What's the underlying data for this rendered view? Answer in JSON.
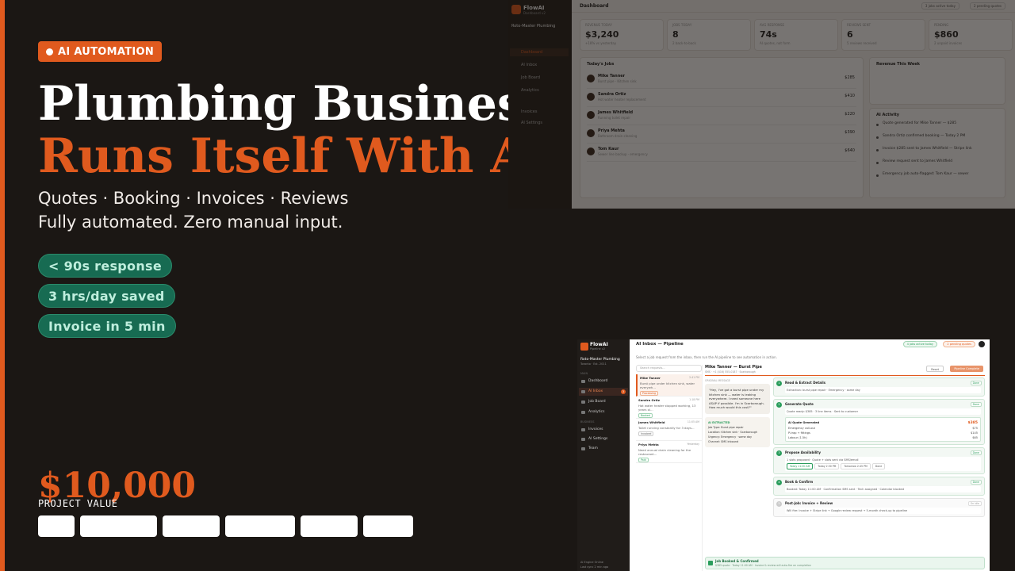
{
  "hero": {
    "badge": "AI AUTOMATION",
    "headline_1": "Plumbing Business",
    "headline_2": "Runs Itself With AI",
    "subline_1": "Quotes · Booking · Invoices · Reviews",
    "subline_2": "Fully automated. Zero manual input.",
    "pills": [
      "< 90s response",
      "3 hrs/day saved",
      "Invoice in 5 min"
    ],
    "price": "$10,000",
    "price_label": "PROJECT VALUE",
    "accent_color": "#e05a1e",
    "pill_color": "#176b52"
  },
  "dashboard": {
    "app_name": "FlowAI",
    "app_sub": "Dashboard v2",
    "business": "Roto-Master Plumbing",
    "nav": [
      "Dashboard",
      "AI Inbox",
      "Job Board",
      "Analytics",
      "Invoices",
      "AI Settings"
    ],
    "title": "Dashboard",
    "top_buttons": [
      "3 jobs active today",
      "2 pending quotes"
    ],
    "stats": [
      {
        "label": "REVENUE TODAY",
        "value": "$3,240",
        "hint": "+18% vs yesterday"
      },
      {
        "label": "JOBS TODAY",
        "value": "8",
        "hint": "2 back-to-back"
      },
      {
        "label": "AVG RESPONSE",
        "value": "74s",
        "hint": "AI quotes, not form"
      },
      {
        "label": "REVIEWS SENT",
        "value": "6",
        "hint": "5 reviews received"
      },
      {
        "label": "PENDING",
        "value": "$860",
        "hint": "2 unpaid invoices"
      }
    ],
    "jobs_title": "Today's Jobs",
    "jobs": [
      {
        "name": "Mike Tanner",
        "desc": "Burst pipe · Kitchen sink",
        "amount": "$285"
      },
      {
        "name": "Sandra Ortiz",
        "desc": "Hot water heater replacement",
        "amount": "$410"
      },
      {
        "name": "James Whitfield",
        "desc": "Running toilet repair",
        "amount": "$220"
      },
      {
        "name": "Priya Mehta",
        "desc": "Bathroom drain cleaning",
        "amount": "$390"
      },
      {
        "name": "Tom Kaur",
        "desc": "Sewer line backup · emergency",
        "amount": "$640"
      }
    ],
    "revenue_title": "Revenue This Week",
    "activity_title": "AI Activity",
    "activity": [
      "Quote generated for Mike Tanner — $285",
      "Sandra Ortiz confirmed booking — Today 2 PM",
      "Invoice $285 sent to James Whitfield — Stripe link",
      "Review request sent to James Whitfield",
      "Emergency job auto-flagged: Tom Kaur — sewer"
    ]
  },
  "inbox": {
    "app_name": "FlowAI",
    "app_sub": "Pipeline v2",
    "business": "Roto-Master Plumbing",
    "business_sub": "Toronto · Est. 2011",
    "section_main": "MAIN",
    "section_business": "BUSINESS",
    "nav": [
      "Dashboard",
      "AI Inbox",
      "Job Board",
      "Analytics",
      "Invoices",
      "AI Settings",
      "Team"
    ],
    "inbox_count": "3",
    "footer_1": "AI Engine Online",
    "footer_2": "Last sync 2 min ago",
    "title": "AI Inbox — Pipeline",
    "desc": "Select a job request from the inbox, then run the AI pipeline to see automation in action.",
    "tag_active": "4 jobs active today",
    "tag_pending": "2 pending quotes",
    "search_placeholder": "Search requests...",
    "requests": [
      {
        "name": "Mike Tanner",
        "time": "2:41 PM",
        "msg": "Burst pipe under kitchen sink, water everywh...",
        "badge": "Processing"
      },
      {
        "name": "Sandra Ortiz",
        "time": "1:18 PM",
        "msg": "Hot water heater stopped working, 13 years ol...",
        "badge": "Booked"
      },
      {
        "name": "James Whitfield",
        "time": "11:05 AM",
        "msg": "Toilet running constantly for 3 days...",
        "badge": "Invoiced"
      },
      {
        "name": "Priya Mehta",
        "time": "Yesterday",
        "msg": "Need annual drain cleaning for the restaurant...",
        "badge": "Paid"
      }
    ],
    "detail_name": "Mike Tanner — Burst Pipe",
    "detail_sub": "SMS · +1 (416) 555-0187 · Scarborough",
    "reset_label": "Reset",
    "run_label": "Pipeline Complete",
    "original_label": "ORIGINAL MESSAGE",
    "message": "\"Hey, I've got a burst pipe under my kitchen sink — water is leaking everywhere. I need someone here ASAP if possible. I'm in Scarborough. How much would this cost?\"",
    "extracted_label": "AI EXTRACTED",
    "extracted": [
      "Job Type: Burst pipe repair",
      "Location: Kitchen sink · Scarborough",
      "Urgency: Emergency · same day",
      "Channel: SMS inbound"
    ],
    "steps": [
      {
        "num": "1",
        "title": "Read & Extract Details",
        "line": "Extraction: burst pipe repair · Emergency · same day",
        "status": "Done"
      },
      {
        "num": "2",
        "title": "Generate Quote",
        "line": "Quote ready: $385 · 3 line items · Sent to customer",
        "status": "Done"
      },
      {
        "num": "3",
        "title": "Propose Availability",
        "line": "1 slots proposed · Quote + slots sent via SMS/email",
        "status": "Done"
      },
      {
        "num": "4",
        "title": "Book & Confirm",
        "line": "Booked: Today 11:00 AM · Confirmation SMS sent · Tech assigned · Calendar blocked",
        "status": "Done"
      },
      {
        "num": "5",
        "title": "Post-Job: Invoice + Review",
        "line": "Will fire: Invoice + Stripe link → Google review request → 5-month check-up to pipeline",
        "status": "On idle"
      }
    ],
    "quote_title": "AI Quote Generated",
    "quote_total": "$385",
    "quote_rows": [
      {
        "label": "Emergency call-out",
        "value": "$75"
      },
      {
        "label": "P-trap + fittings",
        "value": "$145"
      },
      {
        "label": "Labour (1.5h)",
        "value": "$65"
      }
    ],
    "slots": [
      "Today 11:00 AM",
      "Today 2:30 PM",
      "Tomorrow 2:45 PM",
      "Done"
    ],
    "final_title": "Job Booked & Confirmed",
    "final_sub": "$385 quote · Today 11:00 AM · Invoice & review will auto-fire on completion"
  }
}
